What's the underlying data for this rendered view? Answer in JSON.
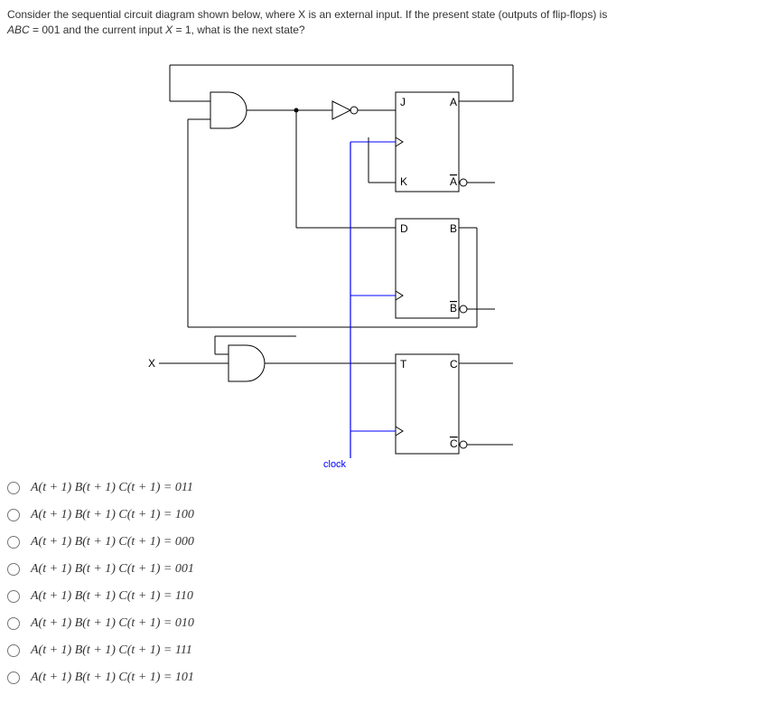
{
  "question": {
    "text_before_abc": "Consider the sequential circuit diagram shown below, where X is an external input. If the present state (outputs of flip-flops) is",
    "abc": "ABC",
    "eq": " = 001",
    "text_mid": " and the current input ",
    "x": "X",
    "eq_x": " = 1",
    "text_after": ", what is the next state?"
  },
  "diagram": {
    "labels": {
      "J": "J",
      "K": "K",
      "A": "A",
      "Abar": "A",
      "D": "D",
      "B": "B",
      "Bbar": "B",
      "T": "T",
      "C": "C",
      "Cbar": "C",
      "X": "X",
      "clock": "clock"
    }
  },
  "answers": [
    "A(t + 1) B(t + 1) C(t + 1) = 011",
    "A(t + 1) B(t + 1) C(t + 1) = 100",
    "A(t + 1) B(t + 1) C(t + 1) = 000",
    "A(t + 1) B(t + 1) C(t + 1) = 001",
    "A(t + 1) B(t + 1) C(t + 1) = 110",
    "A(t + 1) B(t + 1) C(t + 1) = 010",
    "A(t + 1) B(t + 1) C(t + 1) = 111",
    "A(t + 1) B(t + 1) C(t + 1) = 101"
  ]
}
